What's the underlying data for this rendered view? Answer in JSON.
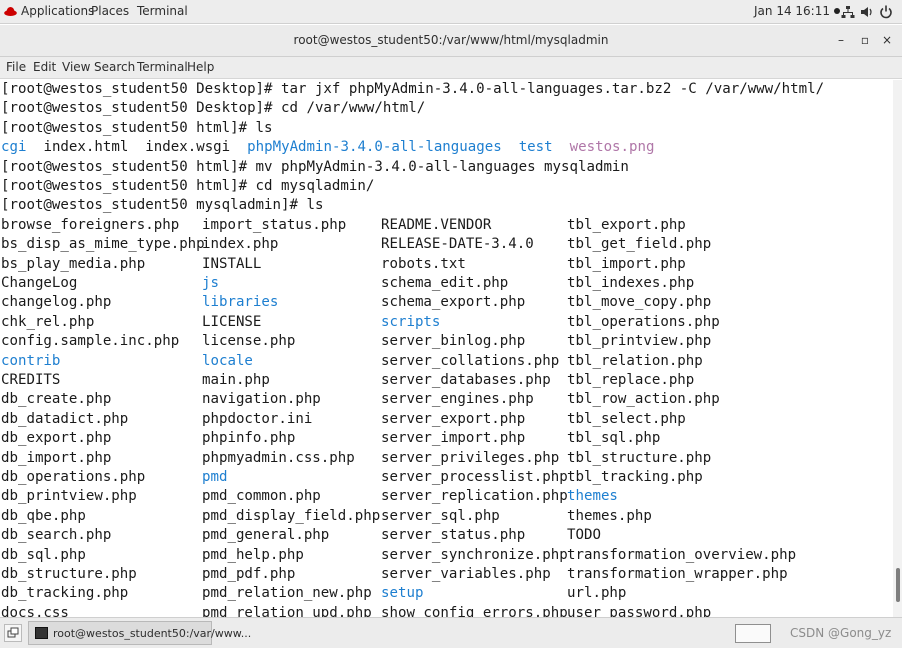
{
  "top_panel": {
    "applications": "Applications",
    "places": "Places",
    "terminal": "Terminal",
    "datetime": "Jan 14 16:11",
    "icons": [
      "redhat-icon",
      "network-icon",
      "volume-icon",
      "power-icon"
    ]
  },
  "window": {
    "title": "root@westos_student50:/var/www/html/mysqladmin",
    "minimize": "–",
    "maximize": "▫",
    "close": "×"
  },
  "menubar": [
    "File",
    "Edit",
    "View",
    "Search",
    "Terminal",
    "Help"
  ],
  "terminal": {
    "lines": [
      "[root@westos_student50 Desktop]# tar jxf phpMyAdmin-3.4.0-all-languages.tar.bz2 -C /var/www/html/",
      "[root@westos_student50 Desktop]# cd /var/www/html/",
      "[root@westos_student50 html]# ls"
    ],
    "ls_html": [
      {
        "text": "cgi",
        "kind": "dir"
      },
      {
        "text": "index.html",
        "kind": "file"
      },
      {
        "text": "index.wsgi",
        "kind": "file"
      },
      {
        "text": "phpMyAdmin-3.4.0-all-languages",
        "kind": "dir"
      },
      {
        "text": "test",
        "kind": "dir"
      },
      {
        "text": "westos.png",
        "kind": "image"
      }
    ],
    "lines2": [
      "[root@westos_student50 html]# mv phpMyAdmin-3.4.0-all-languages mysqladmin",
      "[root@westos_student50 html]# cd mysqladmin/",
      "[root@westos_student50 mysqladmin]# ls"
    ],
    "columns": [
      [
        {
          "t": "browse_foreigners.php",
          "d": false
        },
        {
          "t": "bs_disp_as_mime_type.php",
          "d": false
        },
        {
          "t": "bs_play_media.php",
          "d": false
        },
        {
          "t": "ChangeLog",
          "d": false
        },
        {
          "t": "changelog.php",
          "d": false
        },
        {
          "t": "chk_rel.php",
          "d": false
        },
        {
          "t": "config.sample.inc.php",
          "d": false
        },
        {
          "t": "contrib",
          "d": true
        },
        {
          "t": "CREDITS",
          "d": false
        },
        {
          "t": "db_create.php",
          "d": false
        },
        {
          "t": "db_datadict.php",
          "d": false
        },
        {
          "t": "db_export.php",
          "d": false
        },
        {
          "t": "db_import.php",
          "d": false
        },
        {
          "t": "db_operations.php",
          "d": false
        },
        {
          "t": "db_printview.php",
          "d": false
        },
        {
          "t": "db_qbe.php",
          "d": false
        },
        {
          "t": "db_search.php",
          "d": false
        },
        {
          "t": "db_sql.php",
          "d": false
        },
        {
          "t": "db_structure.php",
          "d": false
        },
        {
          "t": "db_tracking.php",
          "d": false
        },
        {
          "t": "docs.css",
          "d": false
        }
      ],
      [
        {
          "t": "import_status.php",
          "d": false
        },
        {
          "t": "index.php",
          "d": false
        },
        {
          "t": "INSTALL",
          "d": false
        },
        {
          "t": "js",
          "d": true
        },
        {
          "t": "libraries",
          "d": true
        },
        {
          "t": "LICENSE",
          "d": false
        },
        {
          "t": "license.php",
          "d": false
        },
        {
          "t": "locale",
          "d": true
        },
        {
          "t": "main.php",
          "d": false
        },
        {
          "t": "navigation.php",
          "d": false
        },
        {
          "t": "phpdoctor.ini",
          "d": false
        },
        {
          "t": "phpinfo.php",
          "d": false
        },
        {
          "t": "phpmyadmin.css.php",
          "d": false
        },
        {
          "t": "pmd",
          "d": true
        },
        {
          "t": "pmd_common.php",
          "d": false
        },
        {
          "t": "pmd_display_field.php",
          "d": false
        },
        {
          "t": "pmd_general.php",
          "d": false
        },
        {
          "t": "pmd_help.php",
          "d": false
        },
        {
          "t": "pmd_pdf.php",
          "d": false
        },
        {
          "t": "pmd_relation_new.php",
          "d": false
        },
        {
          "t": "pmd_relation_upd.php",
          "d": false
        }
      ],
      [
        {
          "t": "README.VENDOR",
          "d": false
        },
        {
          "t": "RELEASE-DATE-3.4.0",
          "d": false
        },
        {
          "t": "robots.txt",
          "d": false
        },
        {
          "t": "schema_edit.php",
          "d": false
        },
        {
          "t": "schema_export.php",
          "d": false
        },
        {
          "t": "scripts",
          "d": true
        },
        {
          "t": "server_binlog.php",
          "d": false
        },
        {
          "t": "server_collations.php",
          "d": false
        },
        {
          "t": "server_databases.php",
          "d": false
        },
        {
          "t": "server_engines.php",
          "d": false
        },
        {
          "t": "server_export.php",
          "d": false
        },
        {
          "t": "server_import.php",
          "d": false
        },
        {
          "t": "server_privileges.php",
          "d": false
        },
        {
          "t": "server_processlist.php",
          "d": false
        },
        {
          "t": "server_replication.php",
          "d": false
        },
        {
          "t": "server_sql.php",
          "d": false
        },
        {
          "t": "server_status.php",
          "d": false
        },
        {
          "t": "server_synchronize.php",
          "d": false
        },
        {
          "t": "server_variables.php",
          "d": false
        },
        {
          "t": "setup",
          "d": true
        },
        {
          "t": "show_config_errors.php",
          "d": false
        }
      ],
      [
        {
          "t": "tbl_export.php",
          "d": false
        },
        {
          "t": "tbl_get_field.php",
          "d": false
        },
        {
          "t": "tbl_import.php",
          "d": false
        },
        {
          "t": "tbl_indexes.php",
          "d": false
        },
        {
          "t": "tbl_move_copy.php",
          "d": false
        },
        {
          "t": "tbl_operations.php",
          "d": false
        },
        {
          "t": "tbl_printview.php",
          "d": false
        },
        {
          "t": "tbl_relation.php",
          "d": false
        },
        {
          "t": "tbl_replace.php",
          "d": false
        },
        {
          "t": "tbl_row_action.php",
          "d": false
        },
        {
          "t": "tbl_select.php",
          "d": false
        },
        {
          "t": "tbl_sql.php",
          "d": false
        },
        {
          "t": "tbl_structure.php",
          "d": false
        },
        {
          "t": "tbl_tracking.php",
          "d": false
        },
        {
          "t": "themes",
          "d": true
        },
        {
          "t": "themes.php",
          "d": false
        },
        {
          "t": "TODO",
          "d": false
        },
        {
          "t": "transformation_overview.php",
          "d": false
        },
        {
          "t": "transformation_wrapper.php",
          "d": false
        },
        {
          "t": "url.php",
          "d": false
        },
        {
          "t": "user_password.php",
          "d": false
        }
      ]
    ],
    "colors": {
      "dir": "#1e7fd0",
      "image": "#b077a8",
      "text": "#1a1a1a"
    }
  },
  "taskbar": {
    "task_label": "root@westos_student50:/var/www...",
    "watermark": "CSDN @Gong_yz"
  }
}
